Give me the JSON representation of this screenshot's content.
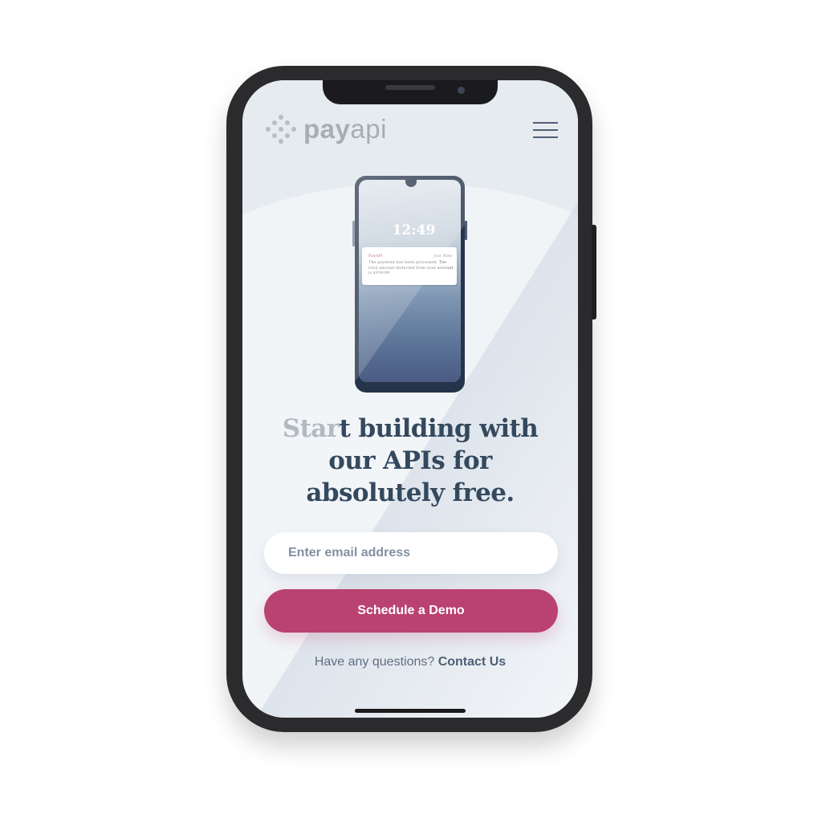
{
  "brand": {
    "logo_word_bold": "pay",
    "logo_word_light": "api",
    "logo_icon": "dot-grid-icon",
    "colors": {
      "primary_dark": "#34495e",
      "accent": "#ba4270",
      "muted": "#8391a3",
      "background": "#f2f5f8"
    }
  },
  "header": {
    "menu_icon": "hamburger-menu-icon"
  },
  "illustration": {
    "time": "12:49",
    "notification": {
      "app": "PayAPI",
      "when": "Just Now",
      "message": "The payment has been processed. The total amount deducted from your account is $104.90"
    }
  },
  "hero": {
    "headline_faded": "Star",
    "headline_rest": "t building with our APIs for absolutely free."
  },
  "form": {
    "email_placeholder": "Enter email address",
    "email_value": "",
    "cta_label": "Schedule a Demo"
  },
  "footer": {
    "question": "Have any questions? ",
    "contact_label": "Contact Us"
  }
}
